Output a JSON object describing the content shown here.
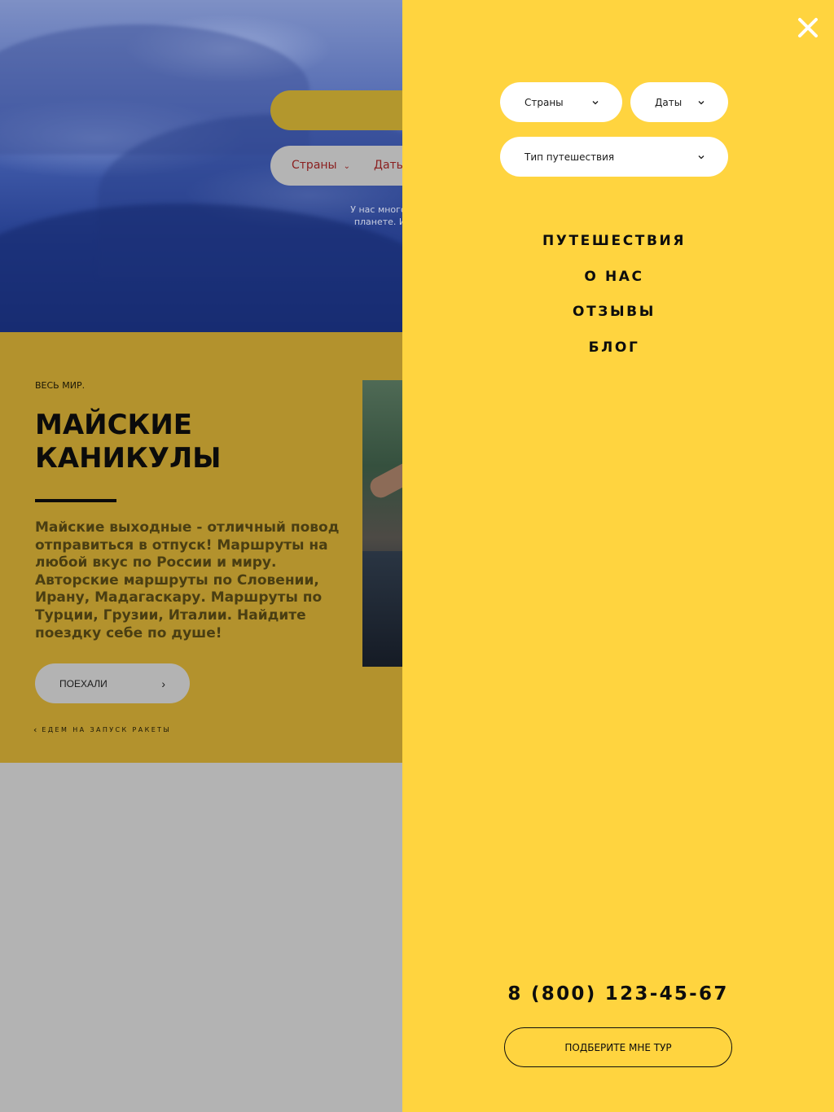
{
  "background_page": {
    "hero": {
      "filter_countries": "Страны",
      "filter_dates": "Даты",
      "tagline": "У нас много невероя\nпланете. И есть од"
    },
    "promo": {
      "kicker": "ВЕСЬ МИР.",
      "title": "МАЙСКИЕ КАНИКУЛЫ",
      "text": "Майские выходные - отличный повод отправиться в отпуск! Маршруты на любой вкус по России и миру. Авторские маршруты по Словении, Ирану, Мадагаскару. Маршруты по Турции, Грузии, Италии. Найдите поездку себе по душе!",
      "button_label": "ПОЕХАЛИ",
      "prev_label": "ЕДЕМ НА ЗАПУСК РАКЕТЫ"
    }
  },
  "drawer": {
    "filters": {
      "countries": "Страны",
      "dates": "Даты",
      "trip_type": "Тип путешествия"
    },
    "nav": [
      {
        "label": "ПУТЕШЕСТВИЯ"
      },
      {
        "label": "О НАС"
      },
      {
        "label": "ОТЗЫВЫ"
      },
      {
        "label": "БЛОГ"
      }
    ],
    "phone": "8 (800) 123-45-67",
    "cta_label": "ПОДБЕРИТЕ МНЕ ТУР"
  },
  "icons": {
    "close": "close-icon",
    "chevron": "chevron-down-icon",
    "arrow": "chevron-right-icon"
  },
  "colors": {
    "drawer_bg": "#ffd43f",
    "promo_bg_dimmed": "#b3922d",
    "page_bg_dimmed": "#b3b3b3",
    "text_dark": "#0d0d0d"
  }
}
